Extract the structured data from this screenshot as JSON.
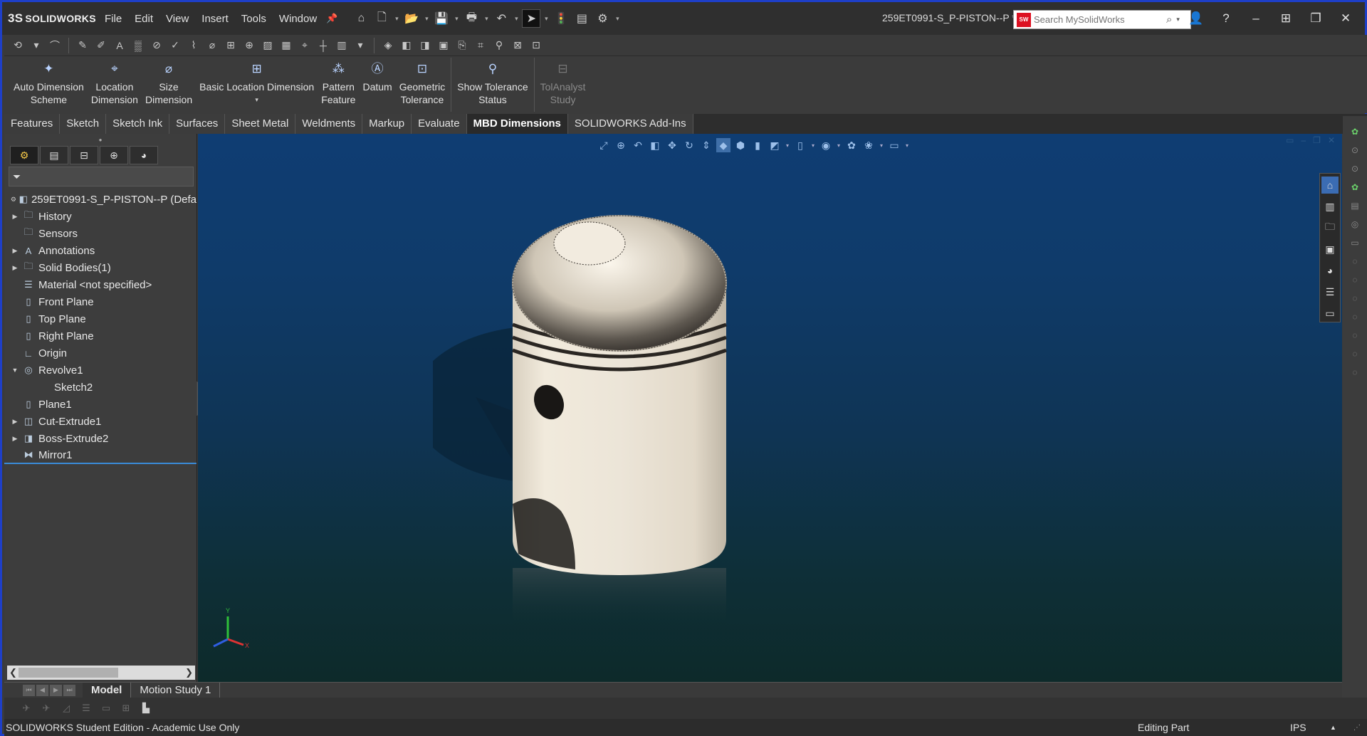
{
  "app": {
    "logo_mark": "3S",
    "logo_text": "SOLIDWORKS",
    "menu": [
      "File",
      "Edit",
      "View",
      "Insert",
      "Tools",
      "Window"
    ],
    "document_title": "259ET0991-S_P-PISTON--P *",
    "search_badge": "SW",
    "search_placeholder": "Search MySolidWorks"
  },
  "ribbon": {
    "buttons": [
      {
        "label_1": "Auto Dimension",
        "label_2": "Scheme",
        "icon": "auto-dimension-icon"
      },
      {
        "label_1": "Location",
        "label_2": "Dimension",
        "icon": "location-dimension-icon"
      },
      {
        "label_1": "Size",
        "label_2": "Dimension",
        "icon": "size-dimension-icon"
      },
      {
        "label_1": "Basic Location Dimension",
        "label_2": "",
        "icon": "basic-location-dimension-icon"
      },
      {
        "label_1": "Pattern",
        "label_2": "Feature",
        "icon": "pattern-feature-icon"
      },
      {
        "label_1": "Datum",
        "label_2": "",
        "icon": "datum-icon"
      },
      {
        "label_1": "Geometric",
        "label_2": "Tolerance",
        "icon": "geometric-tolerance-icon"
      },
      {
        "label_1": "Show Tolerance",
        "label_2": "Status",
        "icon": "show-tolerance-status-icon"
      },
      {
        "label_1": "TolAnalyst",
        "label_2": "Study",
        "icon": "tolanalyst-study-icon"
      }
    ]
  },
  "tabs": [
    "Features",
    "Sketch",
    "Sketch Ink",
    "Surfaces",
    "Sheet Metal",
    "Weldments",
    "Markup",
    "Evaluate",
    "MBD Dimensions",
    "SOLIDWORKS Add-Ins"
  ],
  "active_tab": "MBD Dimensions",
  "tree": {
    "root": "259ET0991-S_P-PISTON--P  (Defa",
    "items": [
      {
        "label": "History",
        "expandable": true
      },
      {
        "label": "Sensors",
        "expandable": false
      },
      {
        "label": "Annotations",
        "expandable": true
      },
      {
        "label": "Solid Bodies(1)",
        "expandable": true
      },
      {
        "label": "Material <not specified>",
        "expandable": false
      },
      {
        "label": "Front Plane",
        "expandable": false
      },
      {
        "label": "Top Plane",
        "expandable": false
      },
      {
        "label": "Right Plane",
        "expandable": false
      },
      {
        "label": "Origin",
        "expandable": false
      },
      {
        "label": "Revolve1",
        "expandable": true
      },
      {
        "label": "Sketch2",
        "expandable": false
      },
      {
        "label": "Plane1",
        "expandable": false
      },
      {
        "label": "Cut-Extrude1",
        "expandable": true
      },
      {
        "label": "Boss-Extrude2",
        "expandable": true
      },
      {
        "label": "Mirror1",
        "expandable": false
      }
    ]
  },
  "triad": {
    "y": "Y",
    "x": "X"
  },
  "bottom_tabs": [
    "Model",
    "Motion Study 1"
  ],
  "status": {
    "left": "SOLIDWORKS Student Edition - Academic Use Only",
    "mode": "Editing Part",
    "units": "IPS"
  },
  "colors": {
    "frame": "#1e3fc8",
    "viewport_top": "#0f3d73",
    "viewport_bottom": "#0d2a2a",
    "piston_body": "#ece4d6",
    "accent_selection": "#3a8bd8"
  }
}
